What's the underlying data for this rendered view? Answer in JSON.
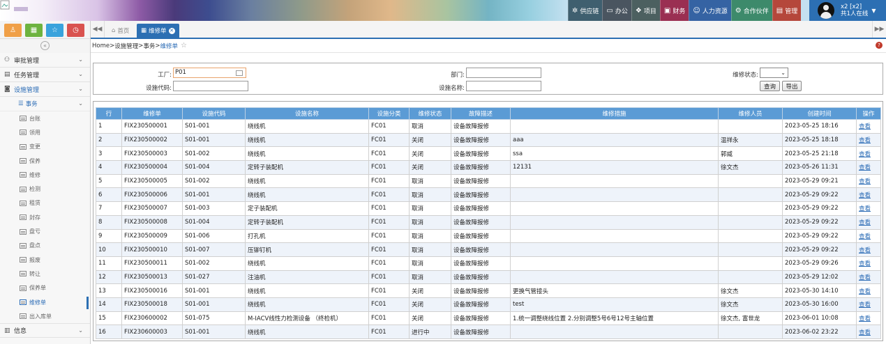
{
  "topnav": [
    {
      "label": "供应链",
      "icon": "supply-chain-icon",
      "bg": "#3f5f6f"
    },
    {
      "label": "办公",
      "icon": "office-icon",
      "bg": "#4a5560"
    },
    {
      "label": "项目",
      "icon": "project-icon",
      "bg": "#4c6060"
    },
    {
      "label": "财务",
      "icon": "finance-icon",
      "bg": "#9a2f52"
    },
    {
      "label": "人力资源",
      "icon": "hr-icon",
      "bg": "#3563a3"
    },
    {
      "label": "合作伙伴",
      "icon": "partner-icon",
      "bg": "#3d8a6b"
    },
    {
      "label": "管理",
      "icon": "admin-icon",
      "bg": "#b5473b"
    }
  ],
  "user": {
    "name": "x2 [x2]",
    "online": "共1人在线"
  },
  "quickbar": [
    {
      "icon": "user-icon",
      "color": "#f0a048"
    },
    {
      "icon": "grid-icon",
      "color": "#6db33f"
    },
    {
      "icon": "star-icon",
      "color": "#3aa3dc"
    },
    {
      "icon": "clock-icon",
      "color": "#d9534f"
    }
  ],
  "tabs": {
    "home": "首页",
    "current": "维修单"
  },
  "breadcrumb": {
    "home": "Home",
    "sep": " > ",
    "level1": "设施管理",
    "level2": "事务",
    "current": "维修单"
  },
  "sidebar": {
    "top": [
      {
        "label": "审批管理",
        "icon": "approval-icon"
      },
      {
        "label": "任务管理",
        "icon": "task-icon"
      },
      {
        "label": "设施管理",
        "icon": "facility-icon"
      }
    ],
    "sub": "事务",
    "leaves": [
      "台账",
      "领用",
      "变更",
      "保养",
      "维修",
      "检测",
      "租赁",
      "封存",
      "盘亏",
      "盘点",
      "报废",
      "转让",
      "保养单",
      "维修单",
      "出入库单"
    ],
    "active_leaf": "维修单",
    "bottom": "信息"
  },
  "filter": {
    "factory_label": "工厂:",
    "factory_value": "P01",
    "code_label": "设施代码:",
    "code_value": "",
    "dept_label": "部门:",
    "dept_value": "",
    "name_label": "设施名称:",
    "name_value": "",
    "status_label": "维修状态:",
    "status_value": "",
    "query_btn": "查询",
    "export_btn": "导出"
  },
  "grid": {
    "headers": [
      "行",
      "维修单",
      "设施代码",
      "设施名称",
      "设施分类",
      "维修状态",
      "故障描述",
      "维修措施",
      "维修人员",
      "创建时间",
      "操作"
    ],
    "action": "查看",
    "rows": [
      [
        "1",
        "FIX230500001",
        "S01-001",
        "绕线机",
        "FC01",
        "取消",
        "设备故障报修",
        "",
        "",
        "2023-05-25 18:16"
      ],
      [
        "2",
        "FIX230500002",
        "S01-001",
        "绕线机",
        "FC01",
        "关闭",
        "设备故障报修",
        "aaa",
        "温祥永",
        "2023-05-25 18:18"
      ],
      [
        "3",
        "FIX230500003",
        "S01-002",
        "绕线机",
        "FC01",
        "关闭",
        "设备故障报修",
        "ssa",
        "郭威",
        "2023-05-25 21:18"
      ],
      [
        "4",
        "FIX230500004",
        "S01-004",
        "定转子装配机",
        "FC01",
        "关闭",
        "设备故障报修",
        "12131",
        "徐文杰",
        "2023-05-26 11:31"
      ],
      [
        "5",
        "FIX230500005",
        "S01-002",
        "绕线机",
        "FC01",
        "取消",
        "设备故障报修",
        "",
        "",
        "2023-05-29 09:21"
      ],
      [
        "6",
        "FIX230500006",
        "S01-001",
        "绕线机",
        "FC01",
        "取消",
        "设备故障报修",
        "",
        "",
        "2023-05-29 09:22"
      ],
      [
        "7",
        "FIX230500007",
        "S01-003",
        "定子装配机",
        "FC01",
        "取消",
        "设备故障报修",
        "",
        "",
        "2023-05-29 09:22"
      ],
      [
        "8",
        "FIX230500008",
        "S01-004",
        "定转子装配机",
        "FC01",
        "取消",
        "设备故障报修",
        "",
        "",
        "2023-05-29 09:22"
      ],
      [
        "9",
        "FIX230500009",
        "S01-006",
        "打孔机",
        "FC01",
        "取消",
        "设备故障报修",
        "",
        "",
        "2023-05-29 09:22"
      ],
      [
        "10",
        "FIX230500010",
        "S01-007",
        "压铆钉机",
        "FC01",
        "取消",
        "设备故障报修",
        "",
        "",
        "2023-05-29 09:22"
      ],
      [
        "11",
        "FIX230500011",
        "S01-002",
        "绕线机",
        "FC01",
        "取消",
        "设备故障报修",
        "",
        "",
        "2023-05-29 09:26"
      ],
      [
        "12",
        "FIX230500013",
        "S01-027",
        "注油机",
        "FC01",
        "取消",
        "设备故障报修",
        "",
        "",
        "2023-05-29 12:02"
      ],
      [
        "13",
        "FIX230500016",
        "S01-001",
        "绕线机",
        "FC01",
        "关闭",
        "设备故障报修",
        "更换气管接头",
        "徐文杰",
        "2023-05-30 14:10"
      ],
      [
        "14",
        "FIX230500018",
        "S01-001",
        "绕线机",
        "FC01",
        "关闭",
        "设备故障报修",
        "test",
        "徐文杰",
        "2023-05-30 16:00"
      ],
      [
        "15",
        "FIX230600002",
        "S01-075",
        "M-IACV线性力检测设备 （终检机）",
        "FC01",
        "关闭",
        "设备故障报修",
        "1.统一调整绕线位置 2.分别调整5号6号12号主轴位置",
        "徐文杰, 富世龙",
        "2023-06-01 10:08"
      ],
      [
        "16",
        "FIX230600003",
        "S01-001",
        "绕线机",
        "FC01",
        "进行中",
        "设备故障报修",
        "",
        "",
        "2023-06-02 23:22"
      ]
    ]
  }
}
